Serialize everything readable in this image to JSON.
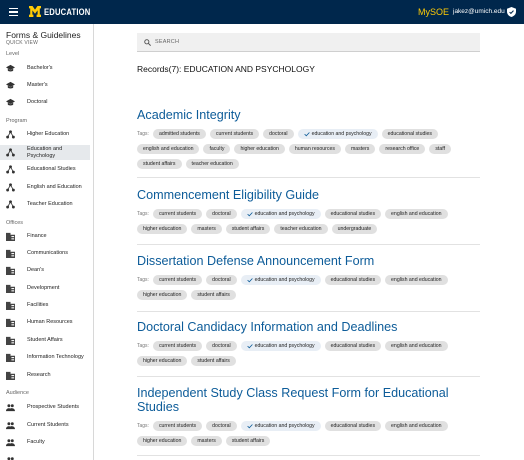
{
  "header": {
    "logo_text": "EDUCATION",
    "mysoe": "MySOE",
    "user_email": "jakez@umich.edu"
  },
  "sidebar": {
    "title": "Forms & Guidelines",
    "subtitle": "QUICK VIEW",
    "sections": {
      "level": "Level",
      "program": "Program",
      "offices": "Offices",
      "audience": "Audience"
    },
    "level_items": [
      "Bachelor's",
      "Master's",
      "Doctoral"
    ],
    "program_items": [
      "Higher Education",
      "Education and Psychology",
      "Educational Studies",
      "English and Education",
      "Teacher Education"
    ],
    "office_items": [
      "Finance",
      "Communications",
      "Dean's",
      "Development",
      "Facilities",
      "Human Resources",
      "Student Affairs",
      "Information Technology",
      "Research"
    ],
    "audience_items": [
      "Prospective Students",
      "Current Students",
      "Faculty"
    ]
  },
  "search": {
    "placeholder": "SEARCH"
  },
  "records_heading": "Records(7): EDUCATION AND PSYCHOLOGY",
  "tags_label": "Tags:",
  "records": [
    {
      "title": "Academic Integrity",
      "tags": [
        "admitted students",
        "current students",
        "doctoral",
        "education and psychology",
        "educational studies",
        "english and education",
        "faculty",
        "higher education",
        "human resources",
        "masters",
        "research office",
        "staff",
        "student affairs",
        "teacher education"
      ]
    },
    {
      "title": "Commencement Eligibility Guide",
      "tags": [
        "current students",
        "doctoral",
        "education and psychology",
        "educational studies",
        "english and education",
        "higher education",
        "masters",
        "student affairs",
        "teacher education",
        "undergraduate"
      ]
    },
    {
      "title": "Dissertation Defense Announcement Form",
      "tags": [
        "current students",
        "doctoral",
        "education and psychology",
        "educational studies",
        "english and education",
        "higher education",
        "student affairs"
      ]
    },
    {
      "title": "Doctoral Candidacy Information and Deadlines",
      "tags": [
        "current students",
        "doctoral",
        "education and psychology",
        "educational studies",
        "english and education",
        "higher education",
        "student affairs"
      ]
    },
    {
      "title": "Independent Study Class Request Form for Educational Studies",
      "tags": [
        "current students",
        "doctoral",
        "education and psychology",
        "educational studies",
        "english and education",
        "higher education",
        "masters",
        "student affairs"
      ]
    }
  ],
  "selected_tag": "education and psychology",
  "colors": {
    "brand_navy": "#00274c",
    "maize": "#ffcb05",
    "link_blue": "#0d5c99"
  }
}
